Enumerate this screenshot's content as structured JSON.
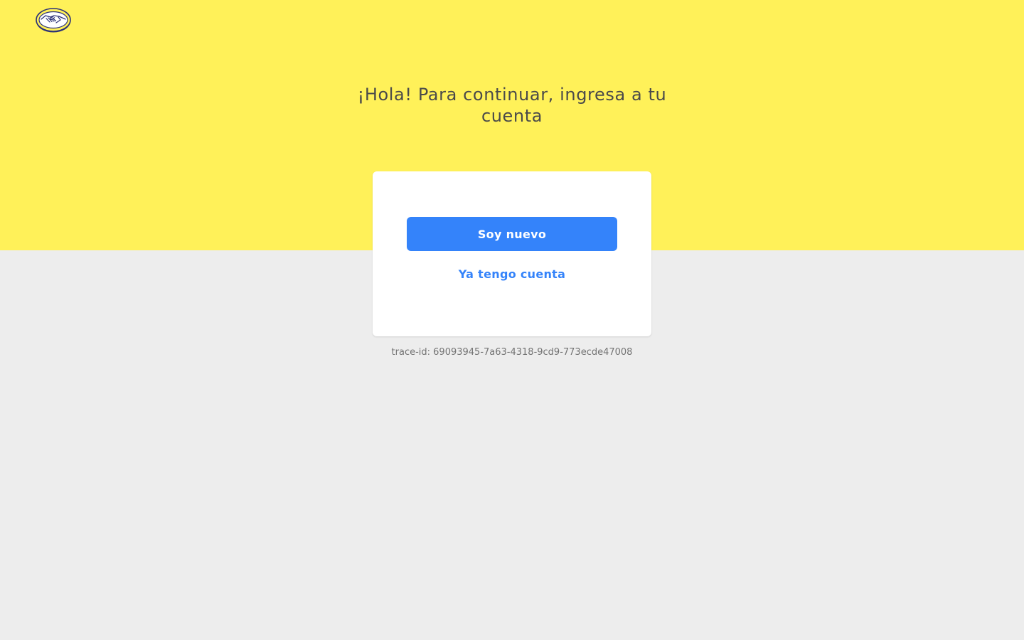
{
  "header": {
    "logo": {
      "icon": "mercadolibre-handshake-logo",
      "colors": {
        "ring": "#2d3277",
        "fill": "#fff159",
        "hands": "#ffffff"
      }
    }
  },
  "main": {
    "title": "¡Hola! Para continuar, ingresa a tu cuenta",
    "new_user_button": "Soy nuevo",
    "existing_account_link": "Ya tengo cuenta",
    "trace_id": "trace-id: 69093945-7a63-4318-9cd9-773ecde47008"
  },
  "colors": {
    "hero_background": "#fff159",
    "page_background": "#ededed",
    "primary_button": "#3483fa",
    "link": "#3483fa",
    "title_text": "#4a4a4a",
    "muted_text": "#737373"
  }
}
